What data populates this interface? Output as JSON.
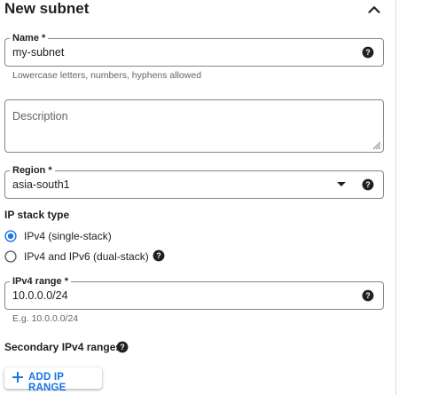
{
  "header": {
    "title": "New subnet"
  },
  "name_field": {
    "label": "Name *",
    "value": "my-subnet",
    "hint": "Lowercase letters, numbers, hyphens allowed"
  },
  "description_field": {
    "placeholder": "Description"
  },
  "region_field": {
    "label": "Region *",
    "value": "asia-south1"
  },
  "ip_stack": {
    "heading": "IP stack type",
    "options": [
      {
        "label": "IPv4 (single-stack)",
        "selected": true
      },
      {
        "label": "IPv4 and IPv6 (dual-stack)",
        "selected": false
      }
    ]
  },
  "ipv4_field": {
    "label": "IPv4 range *",
    "value": "10.0.0.0/24",
    "hint": "E.g. 10.0.0.0/24"
  },
  "secondary": {
    "heading": "Secondary IPv4 ranges",
    "add_button": "ADD IP RANGE"
  },
  "colors": {
    "accent": "#1a73e8",
    "text": "#202124",
    "muted": "#5f6368",
    "border": "#80868b"
  }
}
